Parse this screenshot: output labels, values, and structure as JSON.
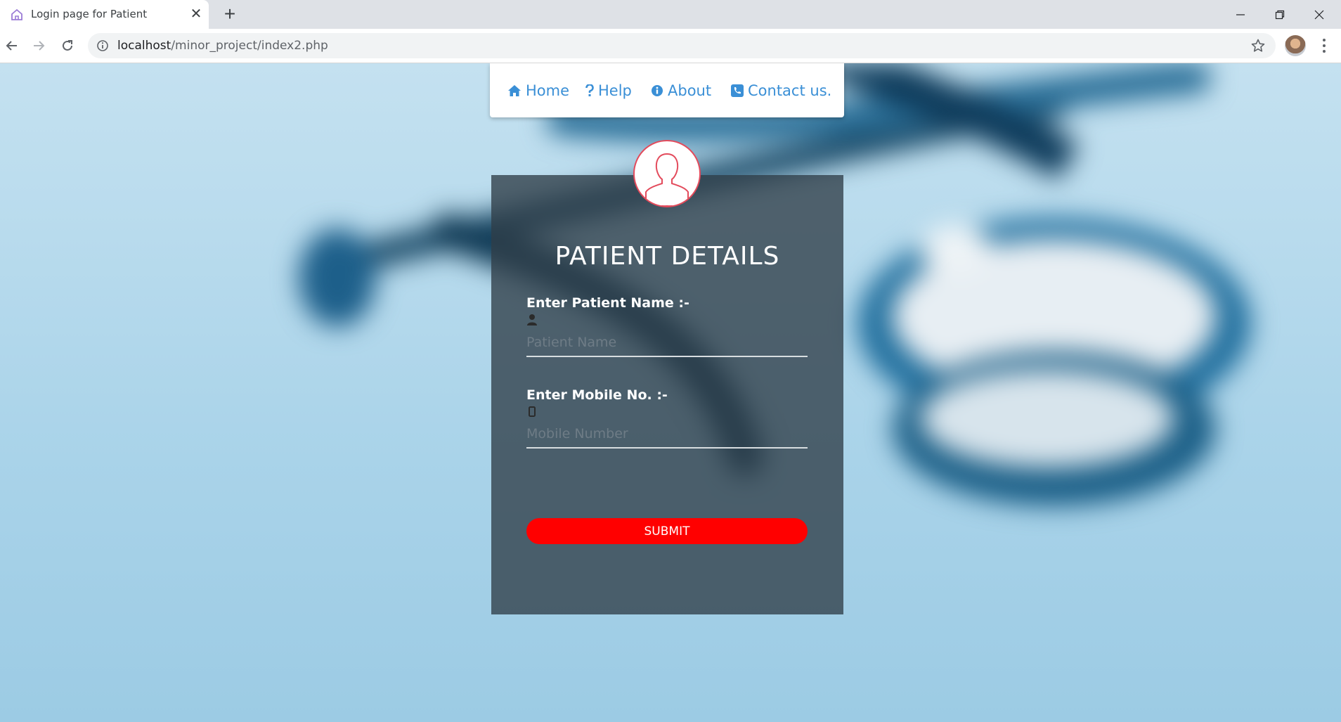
{
  "browser": {
    "tab_title": "Login page for Patient",
    "url_host": "localhost",
    "url_path": "/minor_project/index2.php"
  },
  "nav": {
    "items": [
      {
        "label": "Home",
        "icon": "home-icon"
      },
      {
        "label": "Help",
        "icon": "question-icon"
      },
      {
        "label": "About",
        "icon": "info-icon"
      },
      {
        "label": "Contact us.",
        "icon": "phone-icon"
      }
    ]
  },
  "form": {
    "title": "PATIENT DETAILS",
    "name_label": "Enter Patient Name :-",
    "name_placeholder": "Patient Name",
    "mobile_label": "Enter Mobile No. :-",
    "mobile_placeholder": "Mobile Number",
    "submit_label": "SUBMIT"
  },
  "colors": {
    "nav_link": "#3a8fd6",
    "submit": "#ff0000",
    "avatar_border": "#e34b5c"
  }
}
